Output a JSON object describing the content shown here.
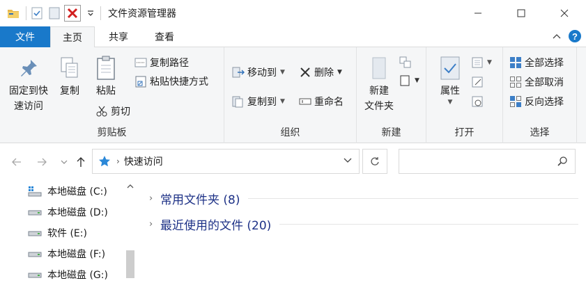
{
  "window": {
    "title": "文件资源管理器"
  },
  "tabs": {
    "file": "文件",
    "home": "主页",
    "share": "共享",
    "view": "查看"
  },
  "ribbon": {
    "clipboard": {
      "label": "剪贴板",
      "pin": "固定到快速访问",
      "pin_line1": "固定到快",
      "pin_line2": "速访问",
      "copy": "复制",
      "paste": "粘贴",
      "copy_path": "复制路径",
      "paste_shortcut": "粘贴快捷方式",
      "cut": "剪切"
    },
    "organize": {
      "label": "组织",
      "move_to": "移动到",
      "copy_to": "复制到",
      "delete": "删除",
      "rename": "重命名"
    },
    "new": {
      "label": "新建",
      "new_folder_line1": "新建",
      "new_folder_line2": "文件夹"
    },
    "open": {
      "label": "打开",
      "properties": "属性"
    },
    "select": {
      "label": "选择",
      "select_all": "全部选择",
      "select_none": "全部取消",
      "invert": "反向选择"
    }
  },
  "address": {
    "crumb": "快速访问",
    "search_placeholder": ""
  },
  "nav": {
    "items": [
      {
        "label": "本地磁盘 (C:)",
        "icon": "windows-drive-icon"
      },
      {
        "label": "本地磁盘 (D:)",
        "icon": "drive-icon"
      },
      {
        "label": "软件 (E:)",
        "icon": "drive-icon"
      },
      {
        "label": "本地磁盘 (F:)",
        "icon": "drive-icon"
      },
      {
        "label": "本地磁盘 (G:)",
        "icon": "drive-icon"
      }
    ]
  },
  "content": {
    "sections": [
      {
        "label": "常用文件夹 (8)"
      },
      {
        "label": "最近使用的文件 (20)"
      }
    ]
  },
  "colors": {
    "accent": "#1979ca",
    "ribbon_bg": "#f5f6f7",
    "section_text": "#1e3287"
  }
}
